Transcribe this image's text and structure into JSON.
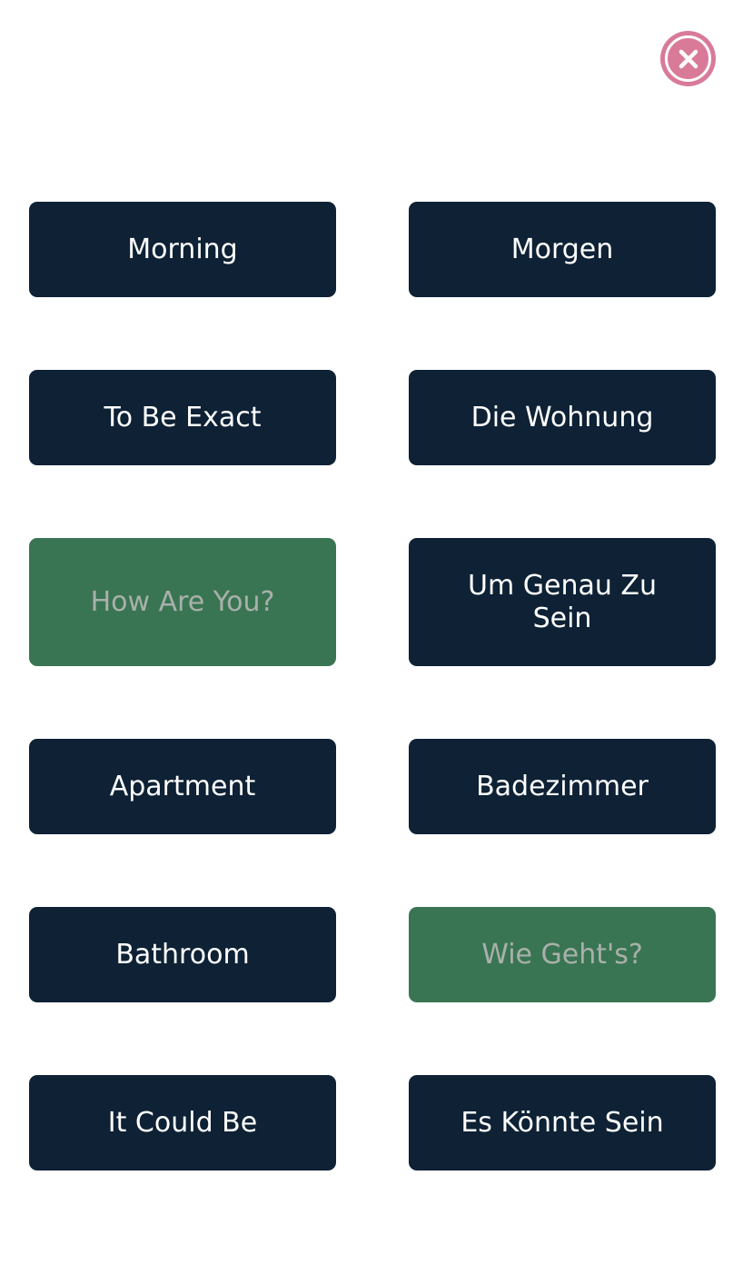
{
  "close_button": {
    "icon": "close-icon",
    "color": "#d97a99"
  },
  "colors": {
    "tile_default": "#0e2135",
    "tile_matched": "#3a7553",
    "text_default": "#ffffff",
    "text_matched": "#a9b0ab"
  },
  "tiles": [
    {
      "label": "Morning",
      "state": "default"
    },
    {
      "label": "Morgen",
      "state": "default"
    },
    {
      "label": "To Be Exact",
      "state": "default"
    },
    {
      "label": "Die Wohnung",
      "state": "default"
    },
    {
      "label": "How Are You?",
      "state": "matched"
    },
    {
      "label": "Um Genau Zu Sein",
      "state": "default"
    },
    {
      "label": "Apartment",
      "state": "default"
    },
    {
      "label": "Badezimmer",
      "state": "default"
    },
    {
      "label": "Bathroom",
      "state": "default"
    },
    {
      "label": "Wie Geht's?",
      "state": "matched"
    },
    {
      "label": "It Could Be",
      "state": "default"
    },
    {
      "label": "Es Könnte Sein",
      "state": "default"
    }
  ]
}
